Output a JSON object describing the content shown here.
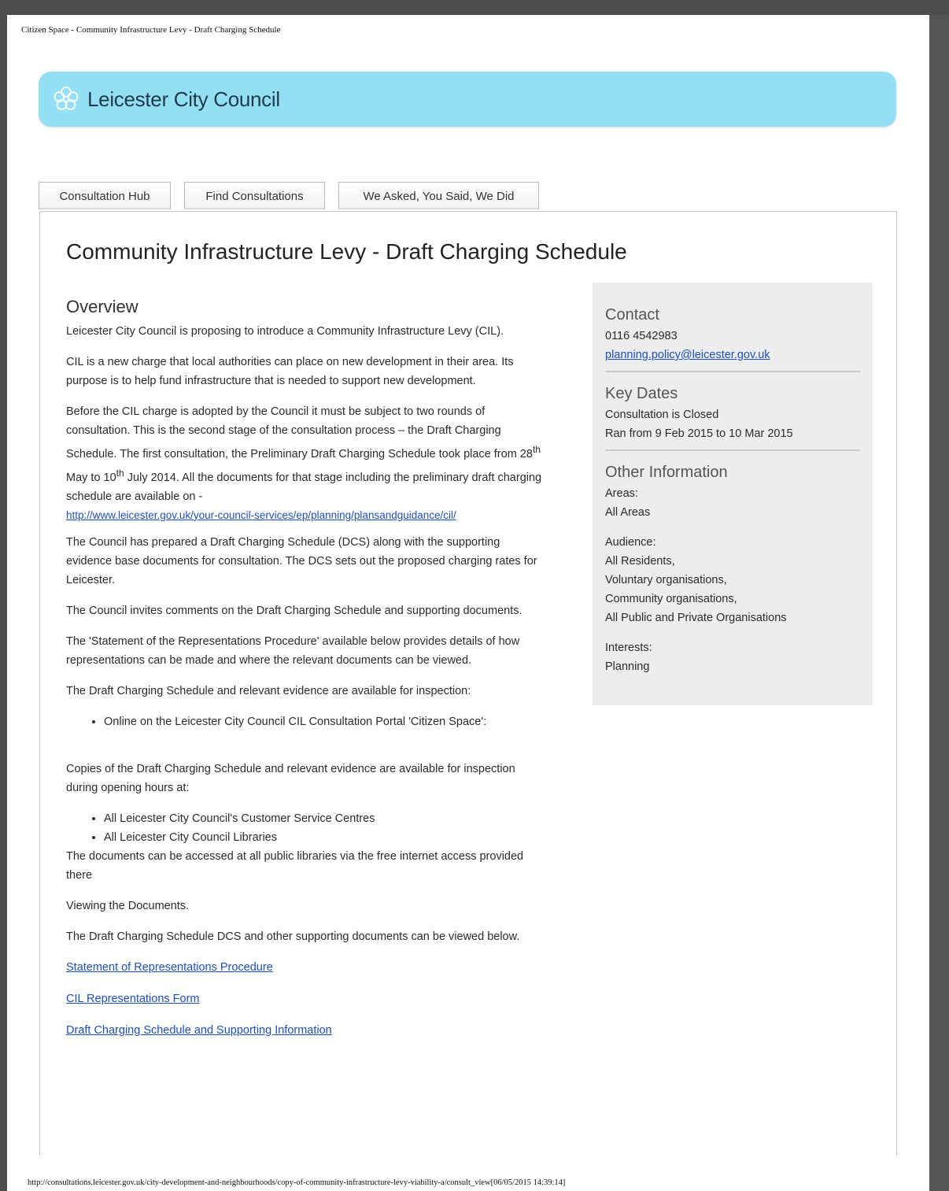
{
  "print_header": "Citizen Space - Community Infrastructure Levy - Draft Charging Schedule",
  "banner": {
    "council_name": "Leicester City Council",
    "logo_icon": "flower-icon"
  },
  "tabs": [
    {
      "label": "Consultation Hub"
    },
    {
      "label": "Find Consultations"
    },
    {
      "label": "We Asked, You Said, We Did"
    }
  ],
  "page_title": "Community Infrastructure Levy - Draft Charging Schedule",
  "overview": {
    "heading": "Overview",
    "p1": "Leicester City Council is proposing to introduce a Community Infrastructure Levy (CIL).",
    "p2": "CIL is a new charge that local authorities can place on new development in their area. Its purpose is to help fund infrastructure that is needed to support new development.",
    "p3_a": "Before the CIL charge is adopted by the Council it must be subject to two rounds of consultation. This is the second stage of the consultation process – the Draft Charging Schedule. The first consultation, the Preliminary Draft Charging Schedule took place from 28",
    "p3_sup1": "th",
    "p3_b": " May to 10",
    "p3_sup2": "th",
    "p3_c": " July 2014. All the documents for that stage including the preliminary draft charging schedule  are available on -",
    "p3_link": "http://www.leicester.gov.uk/your-council-services/ep/planning/plansandguidance/cil/",
    "p4": "The Council has prepared a Draft Charging Schedule (DCS) along with the supporting evidence base documents for consultation. The DCS sets out the proposed charging rates for Leicester.",
    "p5": "The Council invites comments on the Draft Charging Schedule and supporting documents.",
    "p6": "The 'Statement of the Representations Procedure' available below provides details of how representations can be made and where the relevant documents can be viewed.",
    "p7": "The Draft Charging Schedule and relevant evidence are available for inspection:",
    "list1": [
      "Online on the Leicester City Council CIL Consultation Portal 'Citizen Space':"
    ],
    "p8": "Copies of the Draft Charging Schedule and relevant evidence are available for inspection during opening hours at:",
    "list2": [
      "All Leicester City Council's Customer Service Centres",
      "All Leicester City Council Libraries"
    ],
    "p9": "The documents can be accessed at all public libraries via the free internet access provided there",
    "p10": "Viewing the Documents.",
    "p11": "The Draft Charging Schedule DCS and other supporting documents can be viewed below.",
    "doc_links": [
      "Statement of Representations Procedure",
      "CIL Representations Form",
      "Draft Charging Schedule and Supporting Information"
    ]
  },
  "sidebar": {
    "contact": {
      "heading": "Contact",
      "phone": "0116 4542983",
      "email": "planning.policy@leicester.gov.uk"
    },
    "key_dates": {
      "heading": "Key Dates",
      "status": "Consultation is Closed",
      "range": "Ran from 9 Feb 2015 to 10 Mar 2015"
    },
    "other": {
      "heading": "Other Information",
      "areas_label": "Areas:",
      "areas": "All Areas",
      "audience_label": "Audience:",
      "audience": [
        "All Residents,",
        "Voluntary organisations,",
        "Community organisations,",
        "All Public and Private Organisations"
      ],
      "interests_label": "Interests:",
      "interests": "Planning"
    }
  },
  "print_footer": "http://consultations.leicester.gov.uk/city-development-and-neighbourhoods/copy-of-community-infrastructure-levy-viability-a/consult_view[06/05/2015 14:39:14]"
}
